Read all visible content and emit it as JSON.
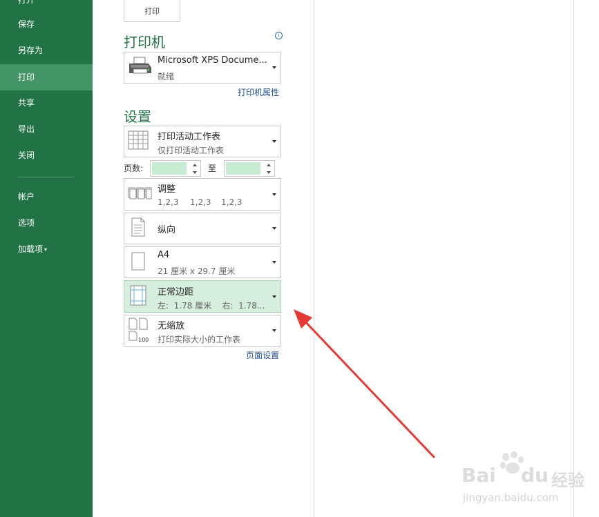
{
  "sidebar": {
    "items": [
      {
        "label": "打开"
      },
      {
        "label": "保存"
      },
      {
        "label": "另存为"
      },
      {
        "label": "打印",
        "selected": true
      },
      {
        "label": "共享"
      },
      {
        "label": "导出"
      },
      {
        "label": "关闭"
      },
      {
        "label": "帐户"
      },
      {
        "label": "选项"
      },
      {
        "label": "加载项"
      }
    ]
  },
  "print_button": {
    "label": "打印"
  },
  "printer": {
    "title": "打印机",
    "name": "Microsoft XPS Docume...",
    "status": "就绪",
    "properties_link": "打印机属性"
  },
  "settings": {
    "title": "设置",
    "scope": {
      "title": "打印活动工作表",
      "sub": "仅打印活动工作表"
    },
    "pages": {
      "label": "页数:",
      "to": "至",
      "from_value": "",
      "to_value": ""
    },
    "collate": {
      "title": "调整",
      "sub": [
        "1,2,3",
        "1,2,3",
        "1,2,3"
      ]
    },
    "orientation": {
      "title": "纵向"
    },
    "paper": {
      "title": "A4",
      "sub": "21 厘米 x 29.7 厘米"
    },
    "margins": {
      "title": "正常边距",
      "sub": "左:  1.78 厘米    右:  1.78..."
    },
    "scaling": {
      "title": "无缩放",
      "sub": "打印实际大小的工作表",
      "icon_text": "100"
    },
    "page_setup_link": "页面设置"
  },
  "watermark": {
    "brand": "Bai",
    "brand2": "du",
    "suffix": "经验",
    "url": "jingyan.baidu.com"
  },
  "colors": {
    "sidebar": "#217346",
    "selected": "#439467",
    "accent": "#217346",
    "highlight": "#d6eedd",
    "arrow": "#e53935"
  }
}
